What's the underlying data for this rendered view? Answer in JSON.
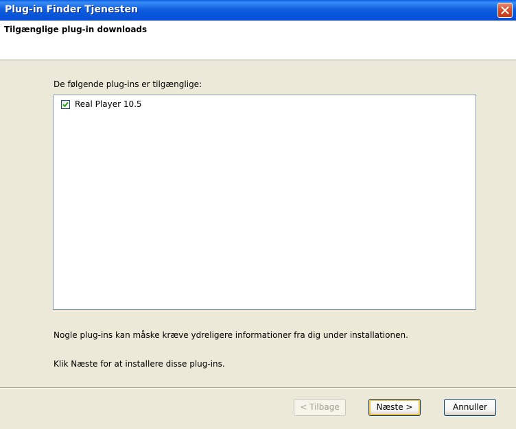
{
  "window": {
    "title": "Plug-in Finder Tjenesten"
  },
  "header": {
    "title": "Tilgænglige plug-in downloads"
  },
  "main": {
    "intro": "De følgende plug-ins er tilgænglige:",
    "plugins": [
      {
        "label": "Real Player 10.5",
        "checked": true
      }
    ],
    "note_info": "Nogle plug-ins kan måske kræve ydreligere informationer fra dig under installationen.",
    "note_next": "Klik Næste for at installere disse plug-ins."
  },
  "footer": {
    "back_label": "< Tilbage",
    "next_label": "Næste >",
    "cancel_label": "Annuller"
  },
  "colors": {
    "titlebar": "#0A5FE8",
    "dialog_bg": "#ECE9D8",
    "close_button": "#D9502C",
    "default_button_ring": "#F0C24C"
  }
}
